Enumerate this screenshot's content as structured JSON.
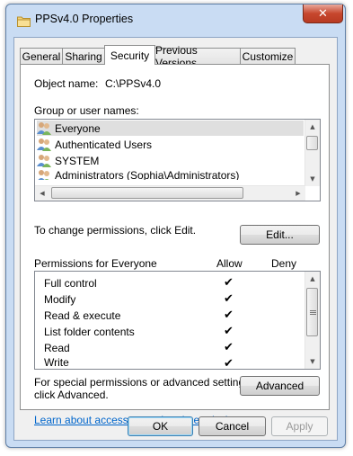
{
  "window": {
    "title": "PPSv4.0 Properties",
    "close_glyph": "✕"
  },
  "tabs": [
    {
      "label": "General",
      "active": false
    },
    {
      "label": "Sharing",
      "active": false
    },
    {
      "label": "Security",
      "active": true
    },
    {
      "label": "Previous Versions",
      "active": false
    },
    {
      "label": "Customize",
      "active": false
    }
  ],
  "security": {
    "object_name_label": "Object name:",
    "object_name_value": "C:\\PPSv4.0",
    "groups_label": "Group or user names:",
    "users": [
      {
        "name": "Everyone",
        "selected": true
      },
      {
        "name": "Authenticated Users",
        "selected": false
      },
      {
        "name": "SYSTEM",
        "selected": false
      },
      {
        "name": "Administrators (Sophia\\Administrators)",
        "selected": false
      }
    ],
    "change_text": "To change permissions, click Edit.",
    "edit_button": "Edit...",
    "permissions_label": "Permissions for Everyone",
    "allow_header": "Allow",
    "deny_header": "Deny",
    "permissions": [
      {
        "name": "Full control",
        "allow": "✔",
        "deny": ""
      },
      {
        "name": "Modify",
        "allow": "✔",
        "deny": ""
      },
      {
        "name": "Read & execute",
        "allow": "✔",
        "deny": ""
      },
      {
        "name": "List folder contents",
        "allow": "✔",
        "deny": ""
      },
      {
        "name": "Read",
        "allow": "✔",
        "deny": ""
      },
      {
        "name": "Write",
        "allow": "✔",
        "deny": ""
      }
    ],
    "special_text_line1": "For special permissions or advanced settings,",
    "special_text_line2": "click Advanced.",
    "advanced_button": "Advanced",
    "help_link": "Learn about access control and permissions"
  },
  "footer": {
    "ok": "OK",
    "cancel": "Cancel",
    "apply": "Apply"
  },
  "colors": {
    "window_frame": "#c9dcf3",
    "link": "#0066cc",
    "selection": "#dfdfdf"
  }
}
